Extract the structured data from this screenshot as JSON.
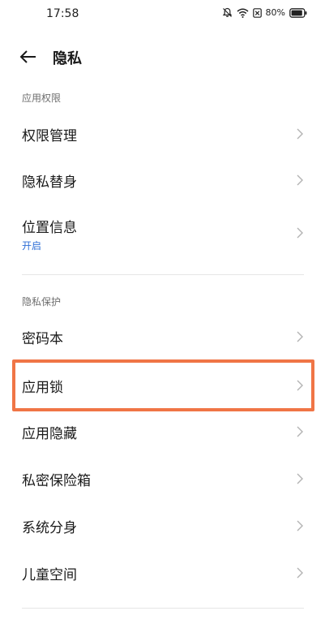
{
  "status_bar": {
    "time": "17:58",
    "battery": "80%"
  },
  "header": {
    "title": "隐私"
  },
  "sections": {
    "permissions": {
      "title": "应用权限",
      "items": [
        {
          "label": "权限管理"
        },
        {
          "label": "隐私替身"
        },
        {
          "label": "位置信息",
          "sub": "开启"
        }
      ]
    },
    "protection": {
      "title": "隐私保护",
      "items": [
        {
          "label": "密码本"
        },
        {
          "label": "应用锁"
        },
        {
          "label": "应用隐藏"
        },
        {
          "label": "私密保险箱"
        },
        {
          "label": "系统分身"
        },
        {
          "label": "儿童空间"
        }
      ]
    }
  },
  "colors": {
    "accent_blue": "#2f6fd6",
    "highlight_orange": "#f07546"
  }
}
